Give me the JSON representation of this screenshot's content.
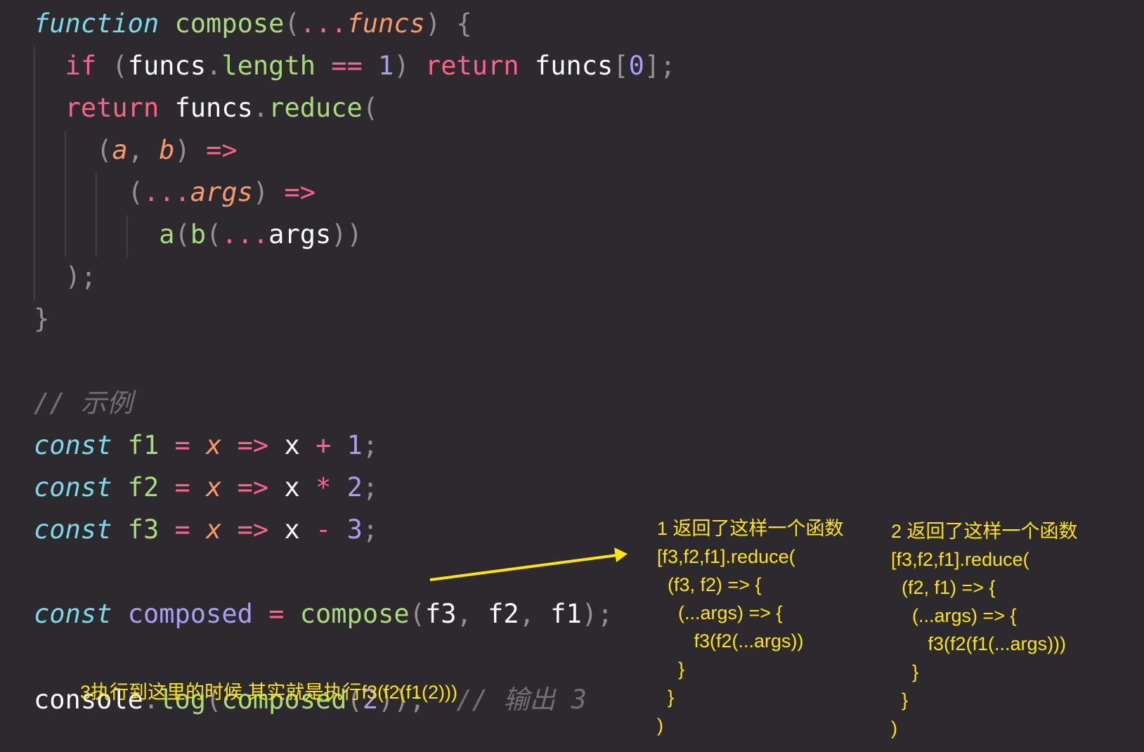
{
  "code": {
    "l1": {
      "kw": "function",
      "name": "compose",
      "open": "(",
      "spread": "...",
      "param": "funcs",
      "close": ")",
      "brace": "{"
    },
    "l2": {
      "kw_if": "if",
      "open": "(",
      "obj": "funcs",
      "dot": ".",
      "prop": "length",
      "op": "==",
      "num": "1",
      "close": ")",
      "kw_return": "return",
      "arr": "funcs",
      "lb": "[",
      "idx": "0",
      "rb": "]",
      "semi": ";"
    },
    "l3": {
      "kw": "return",
      "obj": "funcs",
      "dot": ".",
      "method": "reduce",
      "open": "("
    },
    "l4": {
      "open": "(",
      "a": "a",
      "comma": ",",
      "b": "b",
      "close": ")",
      "arrow": "=>"
    },
    "l5": {
      "open": "(",
      "spread": "...",
      "param": "args",
      "close": ")",
      "arrow": "=>"
    },
    "l6": {
      "a": "a",
      "open1": "(",
      "b": "b",
      "open2": "(",
      "spread": "...",
      "args": "args",
      "close": "))"
    },
    "l7": {
      "close": ");"
    },
    "l8": {
      "brace": "}"
    },
    "l10": {
      "comment": "// 示例"
    },
    "l11": {
      "kw": "const",
      "name": "f1",
      "eq": "=",
      "x": "x",
      "arrow": "=>",
      "var": "x",
      "op": "+",
      "num": "1",
      "semi": ";"
    },
    "l12": {
      "kw": "const",
      "name": "f2",
      "eq": "=",
      "x": "x",
      "arrow": "=>",
      "var": "x",
      "op": "*",
      "num": "2",
      "semi": ";"
    },
    "l13": {
      "kw": "const",
      "name": "f3",
      "eq": "=",
      "x": "x",
      "arrow": "=>",
      "var": "x",
      "op": "-",
      "num": "3",
      "semi": ";"
    },
    "l15": {
      "kw": "const",
      "name": "composed",
      "eq": "=",
      "fn": "compose",
      "open": "(",
      "a1": "f3",
      "c1": ",",
      "a2": "f2",
      "c2": ",",
      "a3": "f1",
      "close": ")",
      "semi": ";"
    },
    "l17": {
      "obj": "console",
      "dot": ".",
      "method": "log",
      "open1": "(",
      "fn": "composed",
      "open2": "(",
      "num": "2",
      "close": "))",
      "semi": ";",
      "comment": "// 输出 3"
    }
  },
  "annotations": {
    "note1": "1 返回了这样一个函数\n[f3,f2,f1].reduce(\n  (f3, f2) => {\n    (...args) => {\n       f3(f2(...args))\n    }\n  }\n)",
    "note2": "2 返回了这样一个函数\n[f3,f2,f1].reduce(\n  (f2, f1) => {\n    (...args) => {\n       f3(f2(f1(...args)))\n    }\n  }\n)",
    "note3": "3执行到这里的时候 其实就是执行f3(f2(f1(2)))"
  },
  "colors": {
    "background": "#2c2a2e",
    "annotation": "#ffe600",
    "keyword": "#ff6188",
    "function": "#a9dc76",
    "param": "#fc9867",
    "number": "#ab9df2",
    "type_keyword": "#78dce8",
    "comment": "#727072"
  }
}
